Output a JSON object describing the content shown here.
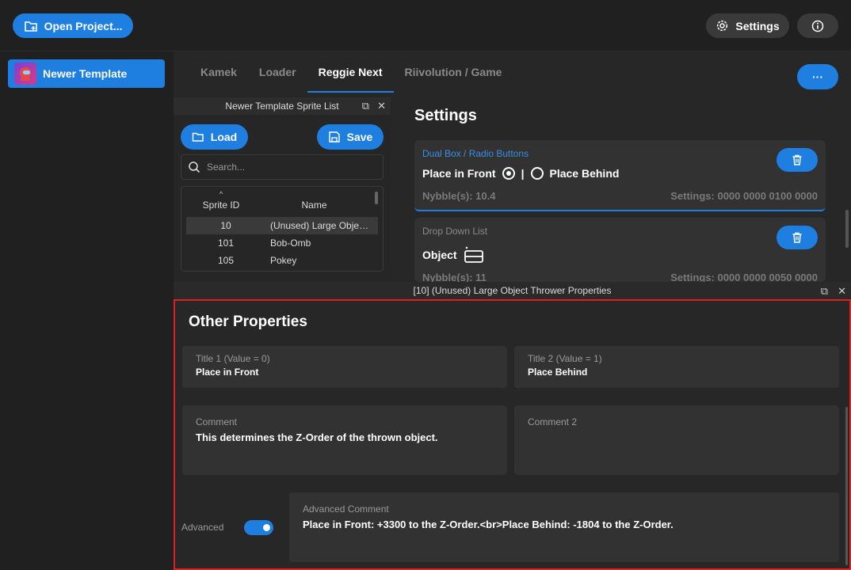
{
  "topbar": {
    "open_project_label": "Open Project...",
    "settings_label": "Settings"
  },
  "sidebar": {
    "items": [
      {
        "label": "Newer Template"
      }
    ]
  },
  "tabs": [
    {
      "label": "Kamek"
    },
    {
      "label": "Loader"
    },
    {
      "label": "Reggie Next"
    },
    {
      "label": "Riivolution / Game"
    }
  ],
  "more_label": "···",
  "sprite_list": {
    "title": "Newer Template Sprite List",
    "load_label": "Load",
    "save_label": "Save",
    "search_placeholder": "Search...",
    "columns": [
      "Sprite ID",
      "Name"
    ],
    "rows": [
      {
        "id": "10",
        "name": "(Unused) Large Object Thrower"
      },
      {
        "id": "101",
        "name": "Bob-Omb"
      },
      {
        "id": "105",
        "name": "Pokey"
      }
    ]
  },
  "settings": {
    "title": "Settings",
    "cards": [
      {
        "type": "Dual Box / Radio Buttons",
        "option1": "Place in Front",
        "separator": "|",
        "option2": "Place Behind",
        "nybbles": "Nybble(s): 10.4",
        "settings": "Settings: 0000 0000 0100 0000"
      },
      {
        "type": "Drop Down List",
        "label": "Object",
        "nybbles": "Nybble(s): 11",
        "settings": "Settings: 0000 0000 0050 0000"
      }
    ]
  },
  "properties": {
    "header": "[10] (Unused) Large Object Thrower Properties",
    "title": "Other Properties",
    "title1_label": "Title 1 (Value = 0)",
    "title1_value": "Place in Front",
    "title2_label": "Title 2 (Value = 1)",
    "title2_value": "Place Behind",
    "comment_label": "Comment",
    "comment_value": "This determines the Z-Order of the thrown object.",
    "comment2_label": "Comment 2",
    "comment2_value": "",
    "advanced_label": "Advanced",
    "advanced_on": true,
    "advanced_comment_label": "Advanced Comment",
    "advanced_comment_value": "Place in Front: +3300 to the Z-Order.<br>Place Behind: -1804 to the Z-Order."
  },
  "colors": {
    "accent": "#1e7fe0",
    "highlight_border": "#e02020",
    "background": "#202020"
  }
}
